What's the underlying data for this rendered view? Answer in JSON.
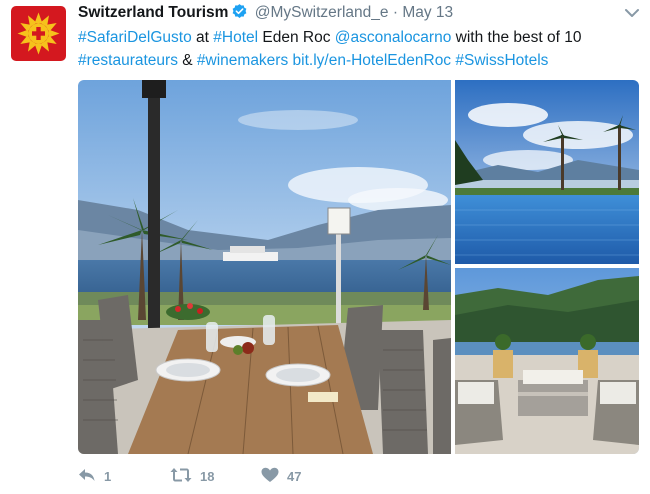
{
  "tweet": {
    "display_name": "Switzerland Tourism",
    "handle": "@MySwitzerland_e",
    "separator": "·",
    "date": "May 13",
    "text_segments": [
      {
        "text": "#SafariDelGusto",
        "link": true
      },
      {
        "text": " at ",
        "link": false
      },
      {
        "text": "#Hotel",
        "link": true
      },
      {
        "text": " Eden Roc ",
        "link": false
      },
      {
        "text": "@asconalocarno",
        "link": true
      },
      {
        "text": " with the best of 10 ",
        "link": false
      },
      {
        "text": "#restaurateurs",
        "link": true
      },
      {
        "text": " & ",
        "link": false
      },
      {
        "text": "#winemakers",
        "link": true
      },
      {
        "text": " ",
        "link": false
      },
      {
        "text": "bit.ly/en-HotelEdenRoc",
        "link": true
      },
      {
        "text": " ",
        "link": false
      },
      {
        "text": "#SwissHotels",
        "link": true
      }
    ],
    "media": [
      {
        "name": "terrace-lake-photo"
      },
      {
        "name": "pool-palms-photo"
      },
      {
        "name": "lounge-mountains-photo"
      }
    ],
    "actions": {
      "reply_count": "1",
      "retweet_count": "18",
      "like_count": "47"
    },
    "icons": {
      "avatar": "swiss-cross-sun-icon",
      "verified": "verified-badge-icon",
      "caret": "chevron-down-icon",
      "reply": "reply-icon",
      "retweet": "retweet-icon",
      "like": "heart-icon"
    },
    "colors": {
      "link": "#1b95e0",
      "brand": "#d4181f",
      "muted": "#657786",
      "action": "#8899a6"
    }
  }
}
